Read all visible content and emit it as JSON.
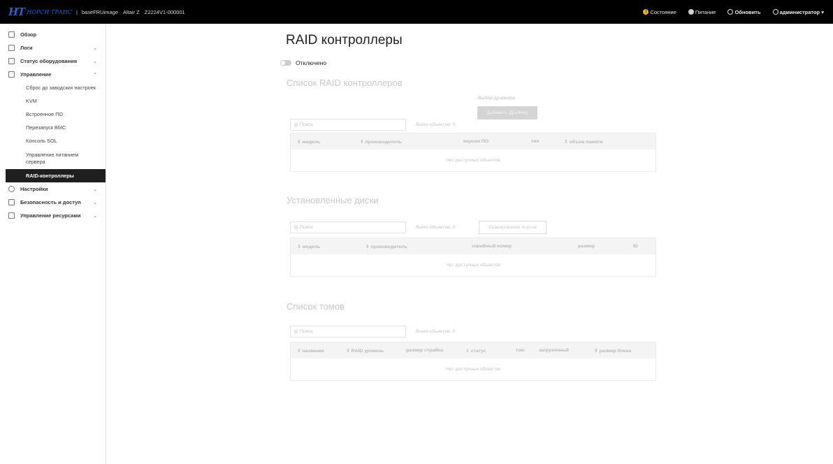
{
  "topbar": {
    "brand_mark": "НТ",
    "brand_text": "НОРСИ-ТРАНС",
    "separator": "|",
    "host": "baseFRUimage",
    "model": "Altair Z",
    "serial": "Z2224V1-000001",
    "status_label": "Состояние",
    "power_label": "Питание",
    "refresh_label": "Обновить",
    "user_label": "администратор ▾"
  },
  "sidebar": {
    "items": [
      {
        "label": "Обзор"
      },
      {
        "label": "Логи",
        "chevron": "⌄"
      },
      {
        "label": "Статус оборудования",
        "chevron": "⌄"
      },
      {
        "label": "Управление",
        "chevron": "⌃"
      }
    ],
    "sub_items": [
      "Сброс до заводских настроек",
      "KVM",
      "Встроенное ПО",
      "Перезапуск BMC",
      "Консоль SOL",
      "Управление питанием сервера",
      "RAID-контроллеры"
    ],
    "bottom_items": [
      {
        "label": "Настройки",
        "chevron": "⌄"
      },
      {
        "label": "Безопасность и доступ",
        "chevron": "⌄"
      },
      {
        "label": "Управление ресурсами",
        "chevron": "⌄"
      }
    ]
  },
  "main": {
    "title": "RAID контроллеры",
    "toggle_label": "Отключено",
    "controllers": {
      "title": "Список RAID контроллеров",
      "driver_label": "Выбор драйвера",
      "add_driver_button": "Добавить Драйвер",
      "search_placeholder": "Поиск",
      "total": "Всего объектов: 0",
      "columns": [
        "модель",
        "производитель",
        "версия ПО",
        "тип",
        "объем памяти"
      ],
      "empty": "Нет доступных объектов"
    },
    "disks": {
      "title": "Установленные диски",
      "search_placeholder": "Поиск",
      "total": "Всего объектов: 0",
      "scan_button": "Сканирование портов",
      "columns": [
        "модель",
        "производитель",
        "серийный номер",
        "размер",
        "ID"
      ],
      "empty": "Нет доступных объектов"
    },
    "volumes": {
      "title": "Список томов",
      "search_placeholder": "Поиск",
      "total": "Всего объектов: 0",
      "columns": [
        "название",
        "RAID уровень",
        "размер страйпа",
        "статус",
        "том",
        "загрузочный",
        "размер блока"
      ],
      "empty": "Нет доступных объектов"
    }
  },
  "colors": {
    "topbar_bg": "#000000",
    "brand": "#1e66d6",
    "warning": "#f0b400",
    "active_nav": "#1f1f1f"
  }
}
